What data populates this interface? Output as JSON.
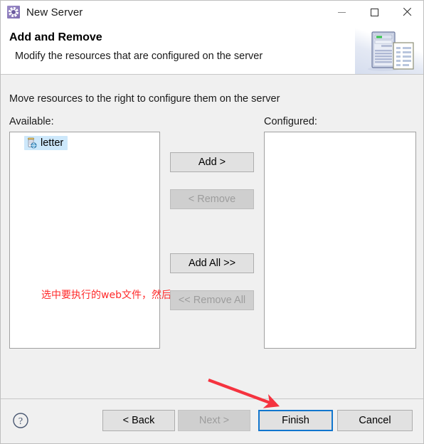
{
  "window": {
    "title": "New Server",
    "icon": "server-gear-icon",
    "controls": {
      "minimize": "minimize-icon",
      "maximize": "maximize-icon",
      "close": "close-icon"
    }
  },
  "header": {
    "title": "Add and Remove",
    "subtitle": "Modify the resources that are configured on the server",
    "banner_icon": "server-tower-document-icon"
  },
  "main": {
    "instruction": "Move resources to the right to configure them on the server",
    "available": {
      "label": "Available:",
      "items": [
        {
          "label": "letter",
          "icon": "web-module-icon",
          "selected": true
        }
      ]
    },
    "configured": {
      "label": "Configured:",
      "items": []
    },
    "annotation": {
      "text": "选中要执行的web文件，然后→",
      "color": "#ff2a2a"
    },
    "transfer_buttons": [
      {
        "label": "Add >",
        "enabled": true
      },
      {
        "label": "< Remove",
        "enabled": false
      },
      {
        "label": "Add All >>",
        "enabled": true
      },
      {
        "label": "<< Remove All",
        "enabled": false
      }
    ]
  },
  "footer": {
    "help_icon": "help-question-icon",
    "buttons": [
      {
        "label": "< Back",
        "enabled": true,
        "focused": false
      },
      {
        "label": "Next >",
        "enabled": false,
        "focused": false
      },
      {
        "label": "Finish",
        "enabled": true,
        "focused": true
      },
      {
        "label": "Cancel",
        "enabled": true,
        "focused": false
      }
    ]
  },
  "annotations": {
    "finish_arrow": {
      "name": "red-arrow-to-finish",
      "color": "#f5333f"
    }
  },
  "colors": {
    "accent": "#1176ce",
    "annotation_red": "#ff2a2a",
    "window_bg": "#f0f0f0",
    "panel_bg": "#ffffff",
    "selection": "#cde8fb"
  }
}
